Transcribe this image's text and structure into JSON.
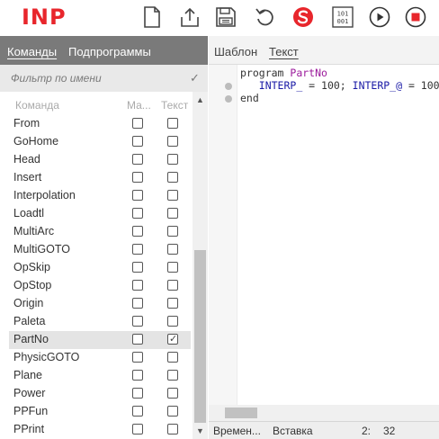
{
  "app": {
    "logo": "INP"
  },
  "toolbar": {
    "buttons": [
      {
        "name": "new-file-button",
        "icon": "file-icon"
      },
      {
        "name": "export-button",
        "icon": "upload-icon"
      },
      {
        "name": "save-button",
        "icon": "floppy-icon"
      },
      {
        "name": "undo-button",
        "icon": "undo-icon"
      },
      {
        "name": "stats-button",
        "icon": "brand-s-icon"
      },
      {
        "name": "binary-button",
        "icon": "binary-icon",
        "text": "101\n001"
      },
      {
        "name": "run-button",
        "icon": "play-icon"
      },
      {
        "name": "stop-button",
        "icon": "stop-icon"
      }
    ],
    "accent": "#e8262c"
  },
  "left": {
    "tabs": [
      "Команды",
      "Подпрограммы"
    ],
    "active_tab": "Команды",
    "filter_placeholder": "Фильтр по имени",
    "columns": {
      "command": "Команда",
      "macro": "Ма...",
      "text": "Текст"
    },
    "rows": [
      {
        "label": "From",
        "macro": false,
        "text": false
      },
      {
        "label": "GoHome",
        "macro": false,
        "text": false
      },
      {
        "label": "Head",
        "macro": false,
        "text": false
      },
      {
        "label": "Insert",
        "macro": false,
        "text": false
      },
      {
        "label": "Interpolation",
        "macro": false,
        "text": false
      },
      {
        "label": "Loadtl",
        "macro": false,
        "text": false
      },
      {
        "label": "MultiArc",
        "macro": false,
        "text": false
      },
      {
        "label": "MultiGOTO",
        "macro": false,
        "text": false
      },
      {
        "label": "OpSkip",
        "macro": false,
        "text": false
      },
      {
        "label": "OpStop",
        "macro": false,
        "text": false
      },
      {
        "label": "Origin",
        "macro": false,
        "text": false
      },
      {
        "label": "Paleta",
        "macro": false,
        "text": false
      },
      {
        "label": "PartNo",
        "macro": false,
        "text": true,
        "selected": true
      },
      {
        "label": "PhysicGOTO",
        "macro": false,
        "text": false
      },
      {
        "label": "Plane",
        "macro": false,
        "text": false
      },
      {
        "label": "Power",
        "macro": false,
        "text": false
      },
      {
        "label": "PPFun",
        "macro": false,
        "text": false
      },
      {
        "label": "PPrint",
        "macro": false,
        "text": false
      }
    ]
  },
  "right": {
    "tabs": [
      "Шаблон",
      "Текст"
    ],
    "active_tab": "Текст",
    "code": {
      "line1_kw": "program",
      "line1_id": "PartNo",
      "line2_var1": "INTERP_",
      "line2_mid": " = 100; ",
      "line2_var2": "INTERP_@",
      "line2_end": " = 100",
      "line3": "end"
    },
    "status": {
      "left": "Времен...",
      "mode": "Вставка",
      "line": "2:",
      "col": "32"
    }
  }
}
